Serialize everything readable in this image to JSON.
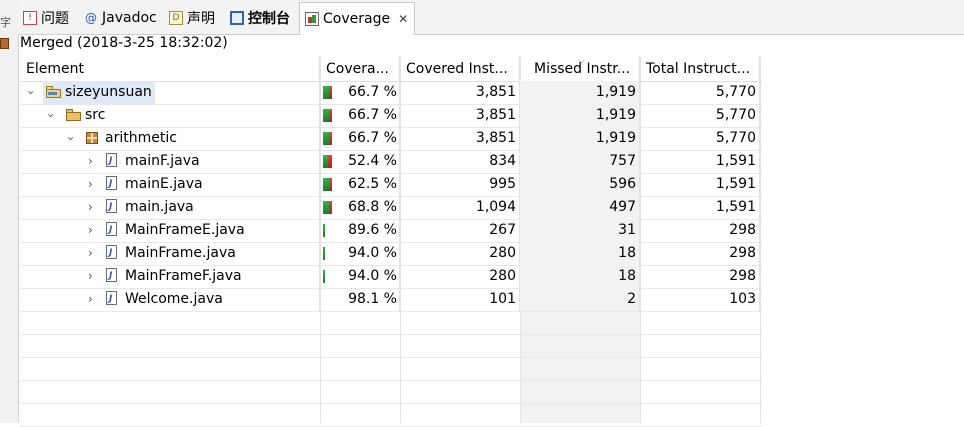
{
  "tabs": [
    {
      "label": "问题",
      "icon": "problems-icon"
    },
    {
      "label": "Javadoc",
      "icon": "at-icon"
    },
    {
      "label": "声明",
      "icon": "declaration-icon"
    },
    {
      "label": "控制台",
      "icon": "console-icon"
    },
    {
      "label": "Coverage",
      "icon": "coverage-icon",
      "active": true,
      "close": "✕"
    }
  ],
  "session": {
    "title": "Merged (2018-3-25 18:32:02)"
  },
  "columns": [
    "Element",
    "Covera...",
    "Covered Inst...",
    "Missed Instr...",
    "Total Instruct..."
  ],
  "rows": [
    {
      "name": "sizeyunsuan",
      "icon": "project-icon",
      "level": 0,
      "expanded": true,
      "coverage": "66.7 %",
      "covered": "3,851",
      "missed": "1,919",
      "total": "5,770",
      "ratio": 0.667
    },
    {
      "name": "src",
      "icon": "source-folder-icon",
      "level": 1,
      "expanded": true,
      "coverage": "66.7 %",
      "covered": "3,851",
      "missed": "1,919",
      "total": "5,770",
      "ratio": 0.667
    },
    {
      "name": "arithmetic",
      "icon": "package-icon",
      "level": 2,
      "expanded": true,
      "coverage": "66.7 %",
      "covered": "3,851",
      "missed": "1,919",
      "total": "5,770",
      "ratio": 0.667
    },
    {
      "name": "mainF.java",
      "icon": "java-file-icon",
      "level": 3,
      "expanded": false,
      "coverage": "52.4 %",
      "covered": "834",
      "missed": "757",
      "total": "1,591",
      "ratio": 0.524
    },
    {
      "name": "mainE.java",
      "icon": "java-file-icon",
      "level": 3,
      "expanded": false,
      "coverage": "62.5 %",
      "covered": "995",
      "missed": "596",
      "total": "1,591",
      "ratio": 0.625
    },
    {
      "name": "main.java",
      "icon": "java-file-icon",
      "level": 3,
      "expanded": false,
      "coverage": "68.8 %",
      "covered": "1,094",
      "missed": "497",
      "total": "1,591",
      "ratio": 0.688
    },
    {
      "name": "MainFrameE.java",
      "icon": "java-file-icon",
      "level": 3,
      "expanded": false,
      "coverage": "89.6 %",
      "covered": "267",
      "missed": "31",
      "total": "298",
      "ratio": 0.896
    },
    {
      "name": "MainFrame.java",
      "icon": "java-file-icon",
      "level": 3,
      "expanded": false,
      "coverage": "94.0 %",
      "covered": "280",
      "missed": "18",
      "total": "298",
      "ratio": 0.94
    },
    {
      "name": "MainFrameF.java",
      "icon": "java-file-icon",
      "level": 3,
      "expanded": false,
      "coverage": "94.0 %",
      "covered": "280",
      "missed": "18",
      "total": "298",
      "ratio": 0.94
    },
    {
      "name": "Welcome.java",
      "icon": "java-file-icon",
      "level": 3,
      "expanded": false,
      "coverage": "98.1 %",
      "covered": "101",
      "missed": "2",
      "total": "103",
      "ratio": 0.981
    }
  ],
  "colors": {
    "covered_bar": "#2e9a3a",
    "missed_bar": "#c0392b",
    "selection": "#dfeaf7"
  }
}
